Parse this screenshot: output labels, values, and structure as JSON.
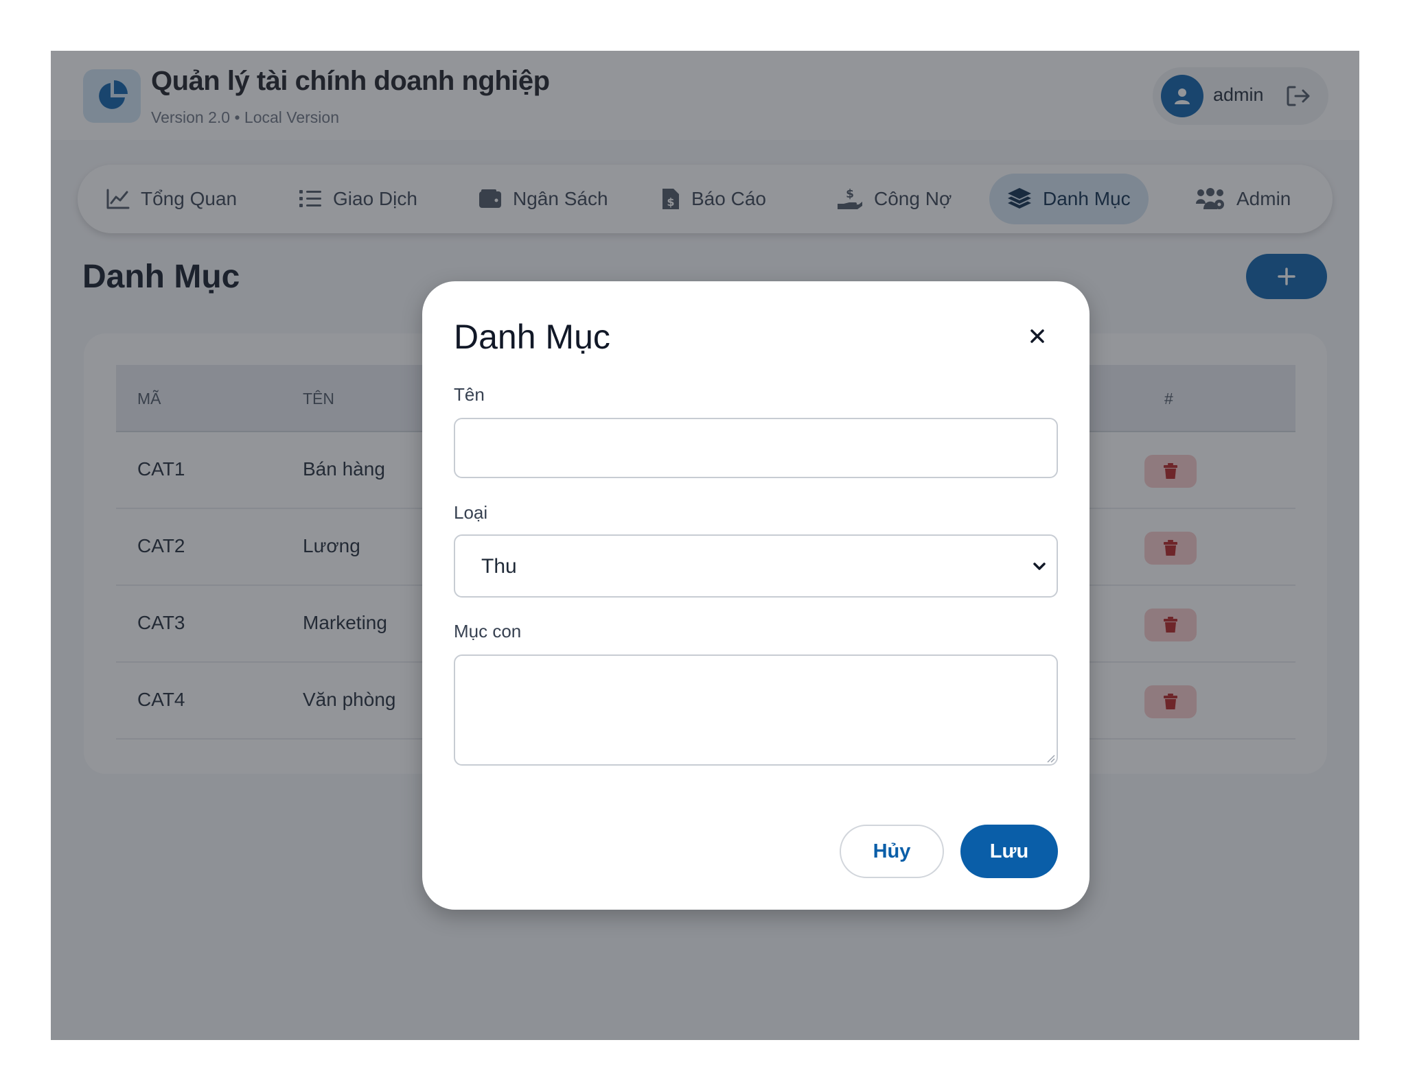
{
  "header": {
    "title": "Quản lý tài chính doanh nghiệp",
    "subtitle": "Version 2.0 • Local Version",
    "logo_icon": "pie-chart-icon",
    "user": {
      "name": "admin",
      "avatar_icon": "user-icon",
      "logout_icon": "logout-icon"
    }
  },
  "nav": {
    "items": [
      {
        "label": "Tổng Quan",
        "icon": "line-chart-icon",
        "active": false
      },
      {
        "label": "Giao Dịch",
        "icon": "list-icon",
        "active": false
      },
      {
        "label": "Ngân Sách",
        "icon": "wallet-icon",
        "active": false
      },
      {
        "label": "Báo Cáo",
        "icon": "invoice-icon",
        "active": false
      },
      {
        "label": "Công Nợ",
        "icon": "hand-dollar-icon",
        "active": false
      },
      {
        "label": "Danh Mục",
        "icon": "layers-icon",
        "active": true
      },
      {
        "label": "Admin",
        "icon": "users-gear-icon",
        "active": false
      }
    ]
  },
  "page": {
    "title": "Danh Mục",
    "add_button_icon": "plus-icon"
  },
  "table": {
    "columns": [
      "MÃ",
      "TÊN",
      "#"
    ],
    "rows": [
      {
        "code": "CAT1",
        "name": "Bán hàng"
      },
      {
        "code": "CAT2",
        "name": "Lương"
      },
      {
        "code": "CAT3",
        "name": "Marketing"
      },
      {
        "code": "CAT4",
        "name": "Văn phòng"
      }
    ],
    "delete_icon": "trash-icon"
  },
  "modal": {
    "title": "Danh Mục",
    "close_icon": "close-icon",
    "fields": {
      "name": {
        "label": "Tên",
        "value": "",
        "placeholder": ""
      },
      "type": {
        "label": "Loại",
        "value": "Thu"
      },
      "children": {
        "label": "Mục con",
        "value": "",
        "placeholder": ""
      }
    },
    "cancel_label": "Hủy",
    "save_label": "Lưu"
  },
  "colors": {
    "primary": "#0a5ea8",
    "active_nav": "#d3e2f1",
    "danger_bg": "#f6c9c9",
    "danger_icon": "#b42121"
  }
}
